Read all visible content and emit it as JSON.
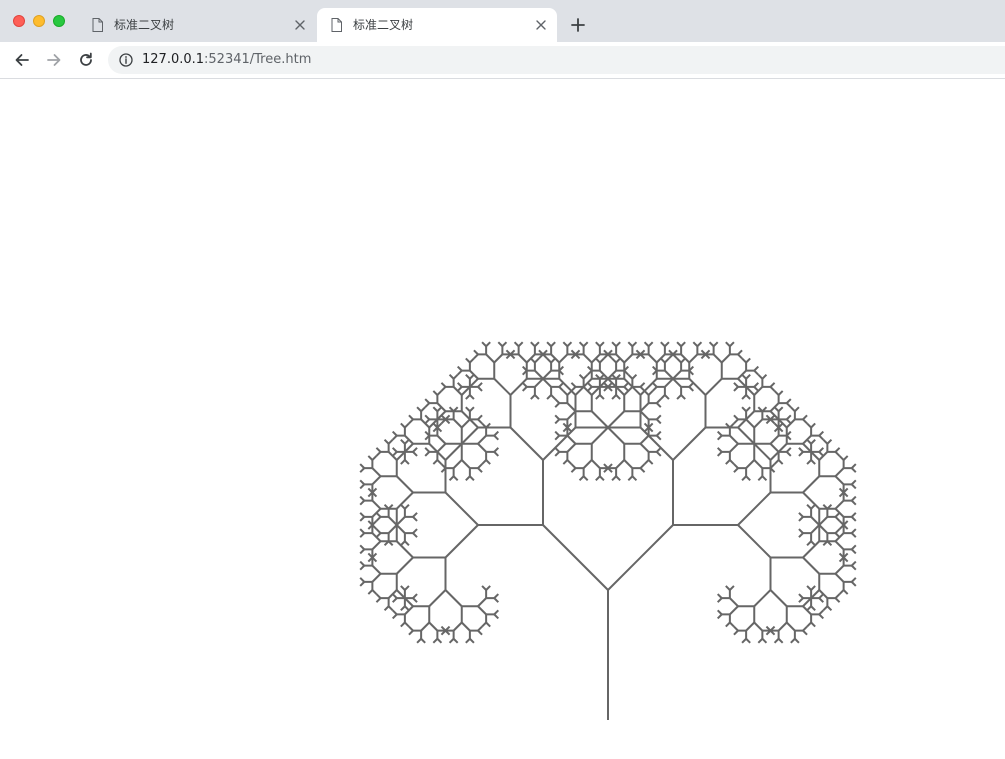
{
  "window": {
    "traffic_lights": {
      "close": "#fe5f57",
      "minimize": "#febc2e",
      "zoom": "#28c840"
    }
  },
  "tabs": [
    {
      "title": "标准二叉树",
      "active": false,
      "icon": "document-icon"
    },
    {
      "title": "标准二叉树",
      "active": true,
      "icon": "document-icon"
    }
  ],
  "toolbar": {
    "back_icon": "arrow-left-icon",
    "forward_icon": "arrow-right-icon",
    "reload_icon": "reload-icon",
    "url_host": "127.0.0.1",
    "url_rest": ":52341/Tree.htm",
    "security_icon": "info-icon"
  },
  "tree": {
    "line_color": "#666666",
    "depth": 9,
    "branch_angle_deg": 45,
    "length_ratio": 0.7071
  }
}
